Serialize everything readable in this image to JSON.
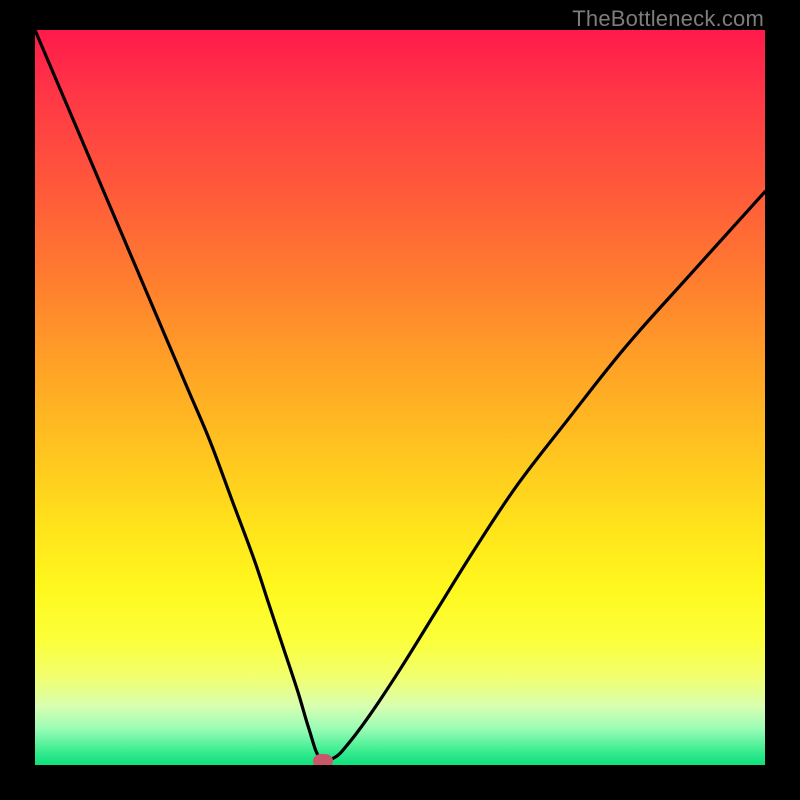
{
  "watermark": "TheBottleneck.com",
  "colors": {
    "curve_stroke": "#000000",
    "marker_fill": "#c9576a",
    "background": "#000000"
  },
  "chart_data": {
    "type": "line",
    "title": "",
    "xlabel": "",
    "ylabel": "",
    "xlim": [
      0,
      100
    ],
    "ylim": [
      0,
      100
    ],
    "grid": false,
    "legend": false,
    "marker": {
      "x": 39.5,
      "y": 0.5
    },
    "series": [
      {
        "name": "bottleneck-curve",
        "x": [
          0,
          3,
          6,
          9,
          12,
          15,
          18,
          21,
          24,
          27,
          30,
          32,
          34,
          36,
          37.5,
          39,
          41,
          43,
          46,
          50,
          55,
          60,
          66,
          73,
          81,
          90,
          100
        ],
        "values": [
          100,
          93,
          86,
          79,
          72,
          65,
          58,
          51,
          44,
          36,
          28,
          22,
          16,
          10,
          5,
          1,
          1,
          3,
          7,
          13,
          21,
          29,
          38,
          47,
          57,
          67,
          78
        ]
      }
    ]
  }
}
